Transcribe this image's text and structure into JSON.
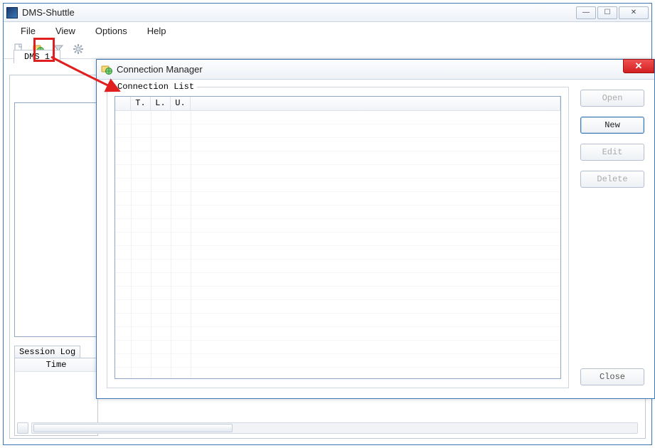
{
  "window": {
    "title": "DMS-Shuttle",
    "min_glyph": "—",
    "max_glyph": "☐",
    "close_glyph": "✕"
  },
  "menu": {
    "file": "File",
    "view": "View",
    "options": "Options",
    "help": "Help"
  },
  "tabs": {
    "doc1": "DMS 1"
  },
  "session_log": {
    "tab": "Session Log",
    "time_col": "Time"
  },
  "dialog": {
    "title": "Connection Manager",
    "group_label": "Connection List",
    "cols": {
      "t": "T.",
      "l": "L.",
      "u": "U."
    },
    "buttons": {
      "open": "Open",
      "new": "New",
      "edit": "Edit",
      "delete": "Delete",
      "close": "Close"
    }
  }
}
